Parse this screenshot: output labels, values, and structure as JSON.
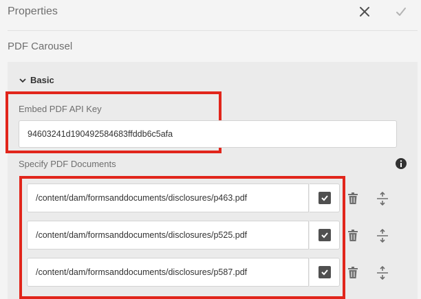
{
  "header": {
    "title": "Properties",
    "close_icon": "close-icon",
    "confirm_icon": "checkmark-icon"
  },
  "component": {
    "name": "PDF Carousel"
  },
  "section": {
    "label": "Basic",
    "icon": "chevron-down-icon"
  },
  "api_key": {
    "label": "Embed PDF API Key",
    "value": "94603241d190492584683ffddb6c5afa"
  },
  "documents": {
    "label": "Specify PDF Documents",
    "info_icon": "info-icon",
    "items": [
      {
        "path": "/content/dam/formsanddocuments/disclosures/p463.pdf",
        "checked": true
      },
      {
        "path": "/content/dam/formsanddocuments/disclosures/p525.pdf",
        "checked": true
      },
      {
        "path": "/content/dam/formsanddocuments/disclosures/p587.pdf",
        "checked": true
      }
    ]
  },
  "colors": {
    "highlight": "#e1251b",
    "background": "#f4f4f4",
    "panel": "#ebebeb"
  }
}
